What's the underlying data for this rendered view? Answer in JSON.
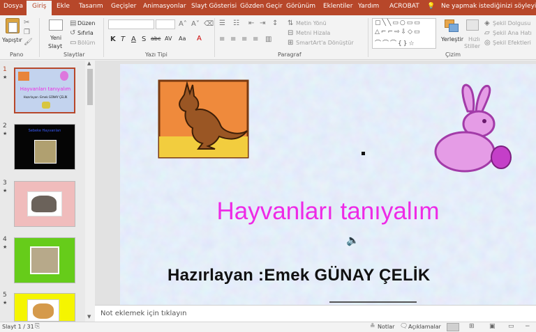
{
  "tabs": [
    "Dosya",
    "Giriş",
    "Ekle",
    "Tasarım",
    "Geçişler",
    "Animasyonlar",
    "Slayt Gösterisi",
    "Gözden Geçir",
    "Görünüm",
    "Eklentiler",
    "Yardım",
    "ACROBAT"
  ],
  "tell_me": "Ne yapmak istediğinizi söyleyin",
  "ribbon": {
    "paste": "Yapıştır",
    "new_slide_1": "Yeni",
    "new_slide_2": "Slayt",
    "layout": "Düzen",
    "reset": "Sıfırla",
    "section": "Bölüm",
    "text_direction": "Metin Yönü",
    "align_text": "Metni Hizala",
    "smartart": "SmartArt'a Dönüştür",
    "arrange": "Yerleştir",
    "quick_styles_1": "Hızlı",
    "quick_styles_2": "Stiller",
    "shape_fill": "Şekil Dolgusu",
    "shape_outline": "Şekil Ana Hatı",
    "shape_effects": "Şekil Efektleri",
    "groups": {
      "clipboard": "Pano",
      "slides": "Slaytlar",
      "font": "Yazı Tipi",
      "paragraph": "Paragraf",
      "drawing": "Çizim"
    },
    "font_buttons": [
      "K",
      "T",
      "A",
      "S",
      "abc",
      "AV",
      "Aa"
    ]
  },
  "thumbnails": [
    {
      "num": "1",
      "star": "★",
      "title": "Hayvanları tanıyalım",
      "subtitle": "Hazırlayan :Emek GÜNAY ÇELİK",
      "bg": "#c3d3ee"
    },
    {
      "num": "2",
      "star": "★",
      "title": "Sebeke Hayvanları",
      "subtitle": "",
      "bg": "#050505"
    },
    {
      "num": "3",
      "star": "★",
      "title": "",
      "subtitle": "",
      "bg": "#f0bcbc"
    },
    {
      "num": "4",
      "star": "★",
      "title": "",
      "subtitle": "",
      "bg": "#66cc1a"
    },
    {
      "num": "5",
      "star": "★",
      "title": "",
      "subtitle": "",
      "bg": "#f5f500"
    }
  ],
  "slide": {
    "title": "Hayvanları tanıyalım",
    "subtitle": "Hazırlayan :Emek GÜNAY ÇELİK",
    "title_color": "#ee2ae6",
    "subtitle_color": "#111111"
  },
  "notes_placeholder": "Not eklemek için tıklayın",
  "status": {
    "slide_info": "Slayt 1 / 31",
    "notes": "Notlar",
    "comments": "Açıklamalar"
  },
  "colors": {
    "accent": "#b7472a"
  }
}
